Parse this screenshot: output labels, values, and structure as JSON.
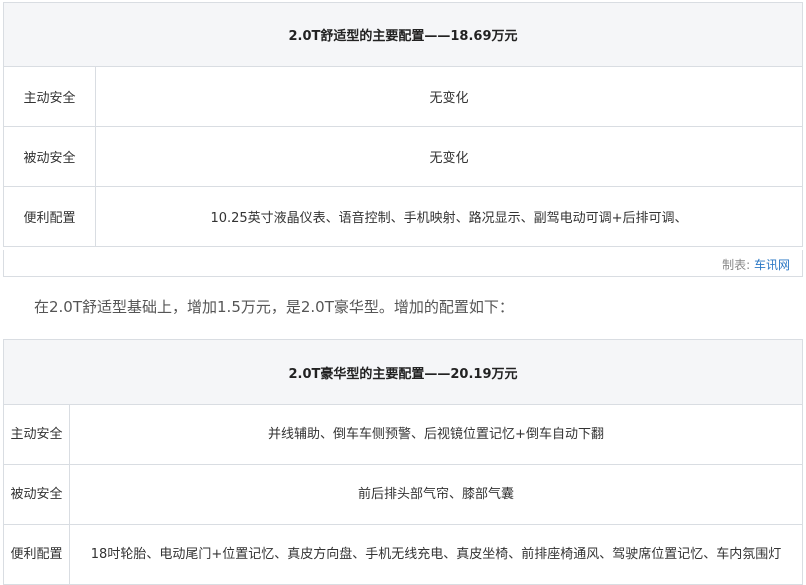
{
  "table1": {
    "title": "2.0T舒适型的主要配置——18.69万元",
    "rows": [
      {
        "label": "主动安全",
        "value": "无变化"
      },
      {
        "label": "被动安全",
        "value": "无变化"
      },
      {
        "label": "便利配置",
        "value": "10.25英寸液晶仪表、语音控制、手机映射、路况显示、副驾电动可调+后排可调、"
      }
    ]
  },
  "credit": {
    "prefix": "制表: ",
    "source": "车讯网"
  },
  "paragraph": "在2.0T舒适型基础上，增加1.5万元，是2.0T豪华型。增加的配置如下：",
  "table2": {
    "title": "2.0T豪华型的主要配置——20.19万元",
    "rows": [
      {
        "label": "主动安全",
        "value": "并线辅助、倒车车侧预警、后视镜位置记忆+倒车自动下翻"
      },
      {
        "label": "被动安全",
        "value": "前后排头部气帘、膝部气囊"
      },
      {
        "label": "便利配置",
        "value": "18吋轮胎、电动尾门+位置记忆、真皮方向盘、手机无线充电、真皮坐椅、前排座椅通风、驾驶席位置记忆、车内氛围灯"
      }
    ]
  }
}
